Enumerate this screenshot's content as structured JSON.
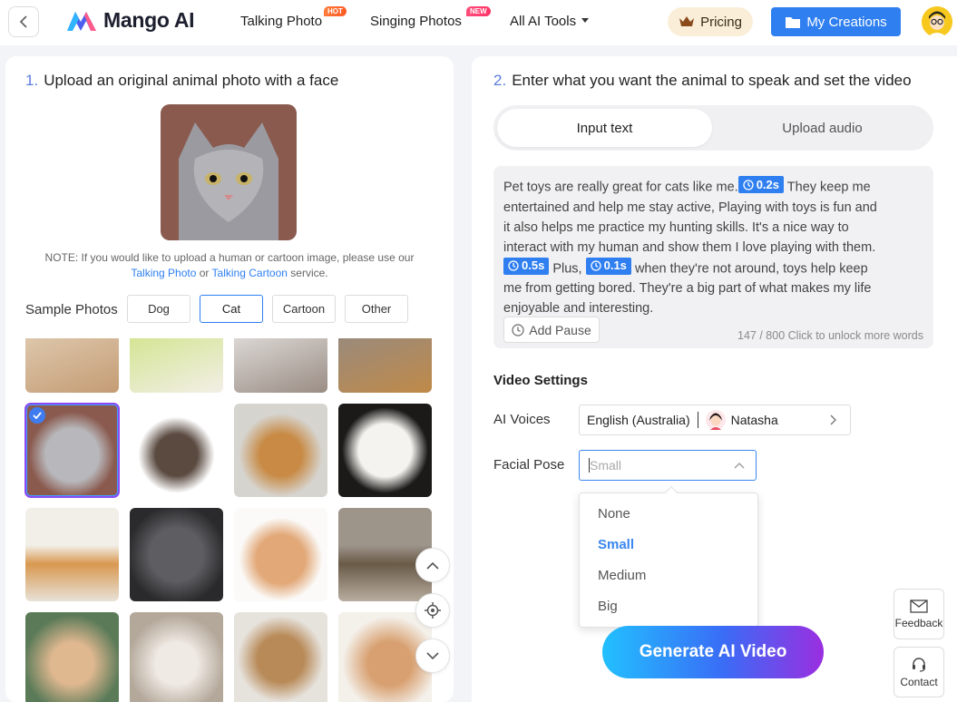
{
  "header": {
    "brand": "Mango AI",
    "nav": [
      {
        "label": "Talking Photo",
        "badge": "HOT"
      },
      {
        "label": "Singing Photos",
        "badge": "NEW"
      },
      {
        "label": "All AI Tools"
      }
    ],
    "pricing_label": "Pricing",
    "creations_label": "My Creations"
  },
  "upload": {
    "step_num": "1.",
    "step_title": "Upload an original animal photo with a face",
    "note_pre": "NOTE: If you would like to upload a human or cartoon image, please use our",
    "note_link1": "Talking Photo",
    "note_or": "or",
    "note_link2": "Talking Cartoon",
    "note_post": "service.",
    "sample_label": "Sample Photos",
    "filters": [
      "Dog",
      "Cat",
      "Cartoon",
      "Other"
    ],
    "active_filter": "Cat"
  },
  "settings": {
    "step_num": "2.",
    "step_title": "Enter what you want the animal to speak and set the video",
    "tabs": [
      "Input text",
      "Upload audio"
    ],
    "active_tab": "Input text",
    "script_parts": {
      "p1": "Pet toys are really great for cats like me.",
      "chip1": "0.2s",
      "p2": " They keep me entertained and help me stay active, Playing with toys is fun and it also helps me practice my hunting skills. It's a nice way to interact with my human and show them I love playing with them.",
      "chip2": "0.5s",
      "p3": " Plus,",
      "chip3": "0.1s",
      "p4": " when they're not around, toys help keep me from getting bored. They're a big part of what makes my life enjoyable and interesting."
    },
    "add_pause_label": "Add Pause",
    "counter": "147 / 800",
    "unlock_text": "Click to unlock more words",
    "video_settings_title": "Video Settings",
    "ai_voices_label": "AI Voices",
    "voice_language": "English (Australia)",
    "voice_name": "Natasha",
    "facial_pose_label": "Facial Pose",
    "facial_pose_placeholder": "Small",
    "pose_options": [
      "None",
      "Small",
      "Medium",
      "Big"
    ],
    "selected_pose": "Small",
    "generate_label": "Generate AI Video"
  },
  "floating": {
    "feedback_label": "Feedback",
    "contact_label": "Contact"
  }
}
